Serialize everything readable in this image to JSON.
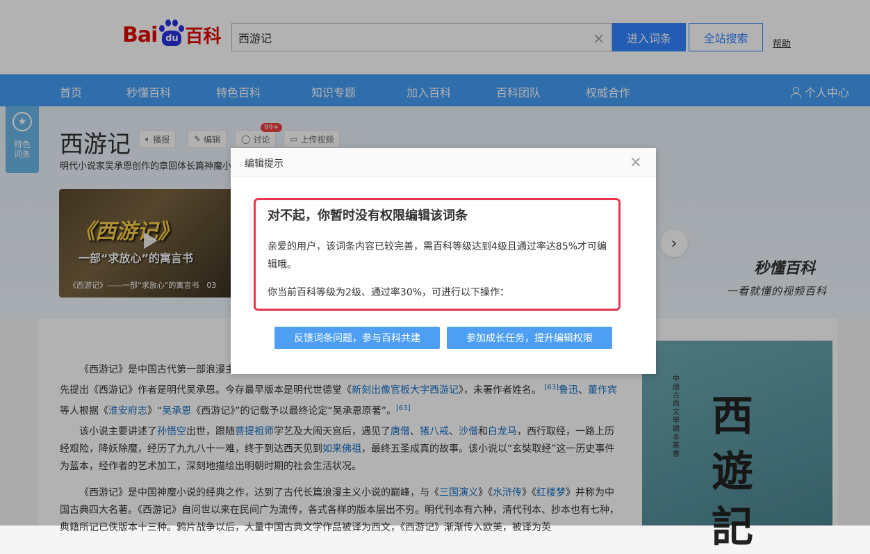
{
  "logo": {
    "bai": "Bai",
    "du": "du",
    "baike": "百科"
  },
  "search": {
    "value": "西游记",
    "clear": "×",
    "enter": "进入词条",
    "all": "全站搜索",
    "help": "帮助"
  },
  "nav": {
    "items": [
      "首页",
      "秒懂百科",
      "特色百科",
      "知识专题",
      "加入百科",
      "百科团队",
      "权威合作"
    ],
    "user": "个人中心"
  },
  "feature_tag": {
    "icon": "★",
    "line1": "特色",
    "line2": "词条"
  },
  "entry": {
    "title": "西游记",
    "tools": {
      "play": "播报",
      "edit": "编辑",
      "discuss": "讨论",
      "upload": "上传视频"
    },
    "badge": "99+",
    "subtitle": "明代小说家吴承恩创作的章回体长篇神魔小说"
  },
  "video": {
    "title": "《西游记》",
    "sub": "一部“求放心”的寓言书",
    "caption": "《西游记》——一部“求放心”的寓言书　03"
  },
  "miaodong": {
    "brand": "秒懂百科",
    "slogan": "一看就懂的视频百科"
  },
  "paragraphs": {
    "p1": {
      "t1": "《西游记》是中国古代第一部浪漫主义章回体长篇神魔小说。现存明刊百回本《西游记》均无作者署名。清代学者吴玉搢等首先提出《西游记》作者是明代吴承恩。今存最早版本是明代世德堂《",
      "l1": "新刻出像官板大字西游记",
      "t2": "》，未署作者姓名。",
      "s1": "[63]",
      "l2": "鲁迅",
      "t3": "、",
      "l3": "董作宾",
      "t4": "等人根据《",
      "l4": "淮安府志",
      "t5": "》“",
      "l5": "吴承恩",
      "t6": "《西游记》”的记载予以最终论定“吴承恩原著”。",
      "s2": "[63]"
    },
    "p2": {
      "t1": "该小说主要讲述了",
      "l1": "孙悟空",
      "t2": "出世，跟随",
      "l2": "菩提祖师",
      "t3": "学艺及大闹天宫后，遇见了",
      "l3": "唐僧",
      "t4": "、",
      "l4": "猪八戒",
      "t5": "、",
      "l5": "沙僧",
      "t6": "和",
      "l6": "白龙马",
      "t7": "，西行取经，一路上历经艰险，降妖除魔，经历了九九八十一难，终于到达西天见到",
      "l7": "如来佛祖",
      "t8": "，最终五圣成真的故事。该小说以“玄奘取经”这一历史事件为蓝本，经作者的艺术加工，深刻地描绘出明朝时期的社会生活状况。"
    },
    "p3": {
      "t1": "《西游记》是中国神魔小说的经典之作，达到了古代长篇浪漫主义小说的巅峰，与《",
      "l1": "三国演义",
      "t2": "》《",
      "l2": "水浒传",
      "t3": "》《",
      "l3": "红楼梦",
      "t4": "》并称为中国古典四大名著。《西游记》自问世以来在民间广为流传，各式各样的版本层出不穷。明代刊本有六种，清代刊本、抄本也有七种，典籍所记已佚版本十三种。鸦片战争以后，大量中国古典文学作品被译为西文，《西游记》渐渐传入欧美，被译为英"
    }
  },
  "book": {
    "g1": "西",
    "g2": "遊",
    "g3": "記",
    "side": "中國古典文學讀本叢書"
  },
  "modal": {
    "header": "编辑提示",
    "close": "×",
    "title": "对不起，你暂时没有权限编辑该词条",
    "body": "亲爱的用户，该词条内容已较完善，需百科等级达到4级且通过率达85%才可编辑哦。",
    "body2": "你当前百科等级为2级、通过率30%，可进行以下操作：",
    "btn1": "反馈词条问题，参与百科共建",
    "btn2": "参加成长任务，提升编辑权限"
  }
}
